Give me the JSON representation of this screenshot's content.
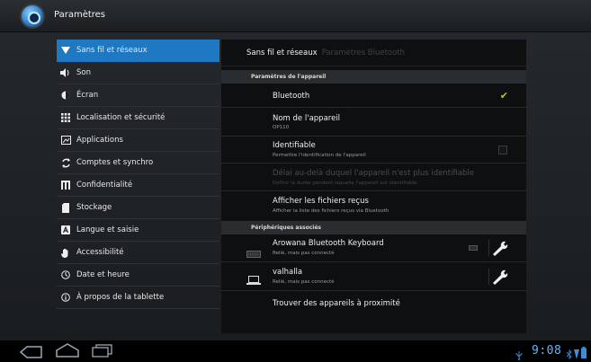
{
  "app": {
    "title": "Paramètres"
  },
  "sidebar": {
    "items": [
      {
        "label": "Sans fil et réseaux",
        "icon": "wifi-icon",
        "selected": true
      },
      {
        "label": "Son",
        "icon": "speaker-icon"
      },
      {
        "label": "Écran",
        "icon": "brightness-icon"
      },
      {
        "label": "Localisation et sécurité",
        "icon": "grid-icon"
      },
      {
        "label": "Applications",
        "icon": "applications-icon"
      },
      {
        "label": "Comptes et synchro",
        "icon": "sync-icon"
      },
      {
        "label": "Confidentialité",
        "icon": "privacy-icon"
      },
      {
        "label": "Stockage",
        "icon": "storage-icon"
      },
      {
        "label": "Langue et saisie",
        "icon": "keyboard-letter-icon"
      },
      {
        "label": "Accessibilité",
        "icon": "hand-icon"
      },
      {
        "label": "Date et heure",
        "icon": "clock-icon"
      },
      {
        "label": "À propos de la tablette",
        "icon": "info-icon"
      }
    ]
  },
  "detail": {
    "breadcrumb": {
      "main": "Sans fil et réseaux",
      "sub": "Paramètres Bluetooth"
    },
    "sections": {
      "device": "Paramètres de l'appareil",
      "paired": "Périphériques associés"
    },
    "settings": {
      "bluetooth": {
        "title": "Bluetooth",
        "checked": true
      },
      "device_name": {
        "title": "Nom de l'appareil",
        "summary": "OP110"
      },
      "discoverable": {
        "title": "Identifiable",
        "summary": "Permettre l'identification de l'appareil",
        "checked": false
      },
      "discoverable_timeout": {
        "title": "Délai au-delà duquel l'appareil n'est plus identifiable",
        "summary": "Définir la durée pendant laquelle l'appareil est identifiable",
        "enabled": false
      },
      "received_files": {
        "title": "Afficher les fichiers reçus",
        "summary": "Afficher la liste des fichiers reçus via Bluetooth"
      }
    },
    "paired_devices": [
      {
        "name": "Arowana Bluetooth Keyboard",
        "status": "Relié, mais pas connecté",
        "icon": "keyboard-icon"
      },
      {
        "name": "valhalla",
        "status": "Relié, mais pas connecté",
        "icon": "laptop-icon"
      }
    ],
    "find_nearby": "Trouver des appareils à proximité"
  },
  "statusbar": {
    "time": "9:08"
  },
  "colors": {
    "accent": "#1e78c2",
    "clock": "#62b4ff",
    "check": "#9fd32f"
  }
}
